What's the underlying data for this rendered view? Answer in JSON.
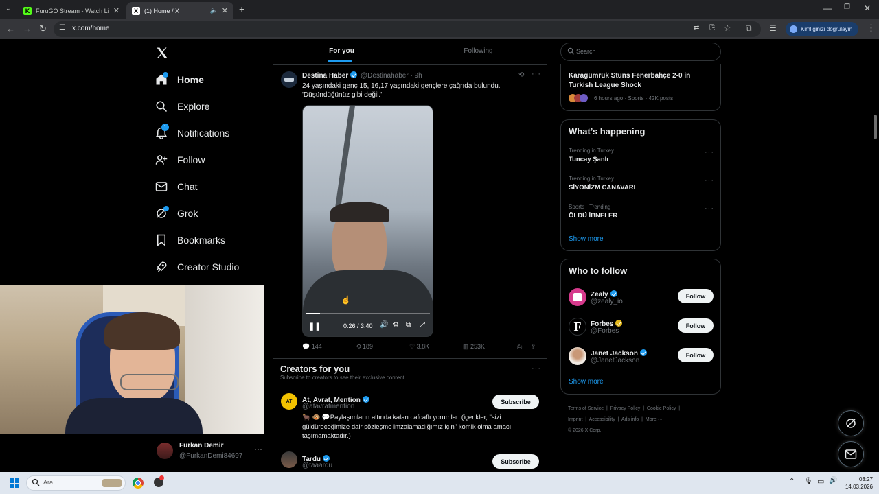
{
  "browser": {
    "tabs": [
      {
        "title": "FuruGO Stream - Watch Live o",
        "favicon": "K",
        "color": "#53fc18"
      },
      {
        "title": "(1) Home / X",
        "favicon": "X",
        "color": "#000000"
      }
    ],
    "new_tab_symbol": "+",
    "url": "x.com/home",
    "profile_label": "Kimliğinizi doğrulayın"
  },
  "x": {
    "nav": [
      {
        "label": "Home",
        "icon": "home-icon"
      },
      {
        "label": "Explore",
        "icon": "search-icon"
      },
      {
        "label": "Notifications",
        "icon": "bell-icon",
        "badge": "1"
      },
      {
        "label": "Follow",
        "icon": "person-plus-icon"
      },
      {
        "label": "Chat",
        "icon": "mail-icon"
      },
      {
        "label": "Grok",
        "icon": "grok-icon"
      },
      {
        "label": "Bookmarks",
        "icon": "bookmark-icon"
      },
      {
        "label": "Creator Studio",
        "icon": "rocket-icon"
      }
    ],
    "account": {
      "name": "Furkan Demir",
      "handle": "@FurkanDemi84697"
    },
    "tabs": {
      "for_you": "For you",
      "following": "Following"
    },
    "post": {
      "author": "Destina Haber",
      "handle": "@Destinahaber",
      "time": "· 9h",
      "text_line1": "24 yaşındaki genç 15, 16,17 yaşındaki gençlere çağrıda bulundu.",
      "text_line2": "'Düşündüğünüz gibi değil.'",
      "video_time": "0:26 / 3:40",
      "video_progress": 0.118,
      "replies": "144",
      "reposts": "189",
      "likes": "3.8K",
      "views": "253K"
    },
    "creators": {
      "title": "Creators for you",
      "subtitle": "Subscribe to creators to see their exclusive content.",
      "items": [
        {
          "name": "At, Avrat, Mention",
          "handle": "@atavratmention",
          "bio_line1": "🐂 🐵 💬Paylaşımların altında kalan cafcaflı yorumlar. (içerikler, \"sizi",
          "bio_line2": "güldüreceğimize dair sözleşme imzalamadığımız için\" komik olma amacı",
          "bio_line3": "taşımamaktadır.)",
          "button": "Subscribe"
        },
        {
          "name": "Tardu",
          "handle": "@taaardu",
          "button": "Subscribe"
        }
      ]
    },
    "search_placeholder": "Search",
    "top_news": {
      "title_line1": "Karagümrük Stuns Fenerbahçe 2-0 in",
      "title_line2": "Turkish League Shock",
      "meta": "6 hours ago · Sports · 42K posts"
    },
    "happening": {
      "title": "What’s happening",
      "items": [
        {
          "context": "Trending in Turkey",
          "topic": "Tuncay Şanlı"
        },
        {
          "context": "Trending in Turkey",
          "topic": "SİYONİZM CANAVARI"
        },
        {
          "context": "Sports · Trending",
          "topic": "ÖLDÜ İBNELER"
        }
      ],
      "show_more": "Show more"
    },
    "who_to_follow": {
      "title": "Who to follow",
      "items": [
        {
          "name": "Zealy",
          "handle": "@zealy_io",
          "badge": "blue",
          "button": "Follow"
        },
        {
          "name": "Forbes",
          "handle": "@Forbes",
          "badge": "gold",
          "button": "Follow"
        },
        {
          "name": "Janet Jackson",
          "handle": "@JanetJackson",
          "badge": "blue",
          "button": "Follow"
        }
      ],
      "show_more": "Show more"
    },
    "footer": {
      "links": [
        "Terms of Service",
        "Privacy Policy",
        "Cookie Policy",
        "Imprint",
        "Accessibility",
        "Ads info",
        "More ···"
      ],
      "copyright": "© 2026 X Corp."
    }
  },
  "taskbar": {
    "search_placeholder": "Ara",
    "time": "03:27",
    "date": "14.03.2026"
  }
}
